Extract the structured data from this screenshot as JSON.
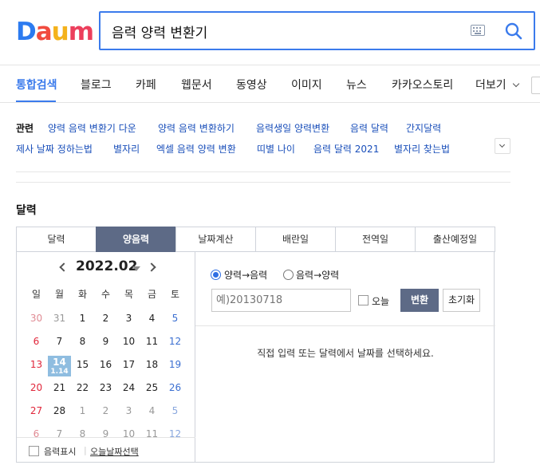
{
  "logo": {
    "letters": [
      "D",
      "a",
      "u",
      "m"
    ],
    "colors": [
      "#2c7bf0",
      "#f14b3f",
      "#f4b21c",
      "#ec3f5c"
    ]
  },
  "search": {
    "query": "음력 양력 변환기"
  },
  "tabs": [
    "통합검색",
    "블로그",
    "카페",
    "웹문서",
    "동영상",
    "이미지",
    "뉴스",
    "카카오스토리",
    "더보기"
  ],
  "related": {
    "title": "관련",
    "links": [
      "양력 음력 변환기 다운",
      "양력 음력 변환하기",
      "음력생일 양력변환",
      "음력 달력",
      "간지달력",
      "제사 날짜 정하는법",
      "별자리",
      "엑셀 음력 양력 변환",
      "띠별 나이",
      "음력 달력 2021",
      "별자리 찾는법"
    ]
  },
  "section_title": "달력",
  "widget": {
    "tabs": [
      "달력",
      "양음력",
      "날짜계산",
      "배란일",
      "전역일",
      "출산예정일"
    ],
    "active_tab": "양음력",
    "calendar": {
      "month": "2022.02",
      "weekdays": [
        "일",
        "월",
        "화",
        "수",
        "목",
        "금",
        "토"
      ],
      "weeks": [
        [
          "30",
          "31",
          "1",
          "2",
          "3",
          "4",
          "5"
        ],
        [
          "6",
          "7",
          "8",
          "9",
          "10",
          "11",
          "12"
        ],
        [
          "13",
          "14",
          "15",
          "16",
          "17",
          "18",
          "19"
        ],
        [
          "20",
          "21",
          "22",
          "23",
          "24",
          "25",
          "26"
        ],
        [
          "27",
          "28",
          "1",
          "2",
          "3",
          "4",
          "5"
        ],
        [
          "6",
          "7",
          "8",
          "9",
          "10",
          "11",
          "12"
        ]
      ],
      "selected": {
        "day": "14",
        "lunar": "1.14"
      },
      "footer": {
        "lunar_toggle": "음력표시",
        "today_link": "오늘날짜선택"
      }
    },
    "converter": {
      "mode_options": [
        "양력→음력",
        "음력→양력"
      ],
      "selected_mode": "양력→음력",
      "input_placeholder": "예)20130718",
      "today_label": "오늘",
      "convert_button": "변환",
      "reset_button": "초기화",
      "message": "직접 입력 또는 달력에서 날짜를 선택하세요."
    }
  }
}
